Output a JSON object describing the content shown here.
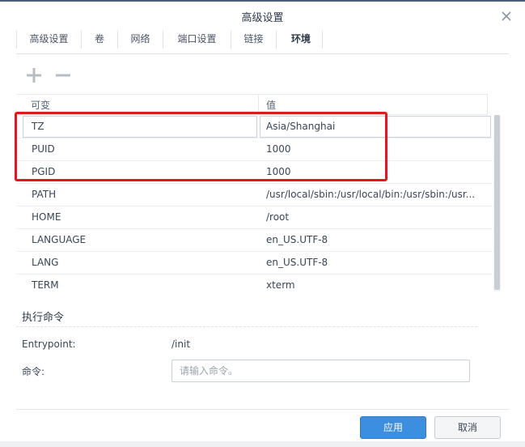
{
  "dialog": {
    "title": "高级设置"
  },
  "tabs": [
    {
      "label": "高级设置"
    },
    {
      "label": "卷"
    },
    {
      "label": "网络"
    },
    {
      "label": "端口设置"
    },
    {
      "label": "链接"
    },
    {
      "label": "环境",
      "active": true
    }
  ],
  "toolbar": {
    "add_icon": "plus-icon",
    "remove_icon": "minus-icon"
  },
  "env_table": {
    "columns": [
      "可变",
      "值"
    ],
    "rows": [
      {
        "name": "TZ",
        "value": "Asia/Shanghai"
      },
      {
        "name": "PUID",
        "value": "1000"
      },
      {
        "name": "PGID",
        "value": "1000"
      },
      {
        "name": "PATH",
        "value": "/usr/local/sbin:/usr/local/bin:/usr/sbin:/usr..."
      },
      {
        "name": "HOME",
        "value": "/root"
      },
      {
        "name": "LANGUAGE",
        "value": "en_US.UTF-8"
      },
      {
        "name": "LANG",
        "value": "en_US.UTF-8"
      },
      {
        "name": "TERM",
        "value": "xterm"
      }
    ]
  },
  "exec": {
    "section_title": "执行命令",
    "entrypoint_label": "Entrypoint:",
    "entrypoint_value": "/init",
    "command_label": "命令:",
    "command_value": "",
    "command_placeholder": "请输入命令。"
  },
  "footer": {
    "apply_label": "应用",
    "cancel_label": "取消"
  },
  "colors": {
    "accent": "#3b8ee0",
    "highlight": "#e0191f"
  }
}
